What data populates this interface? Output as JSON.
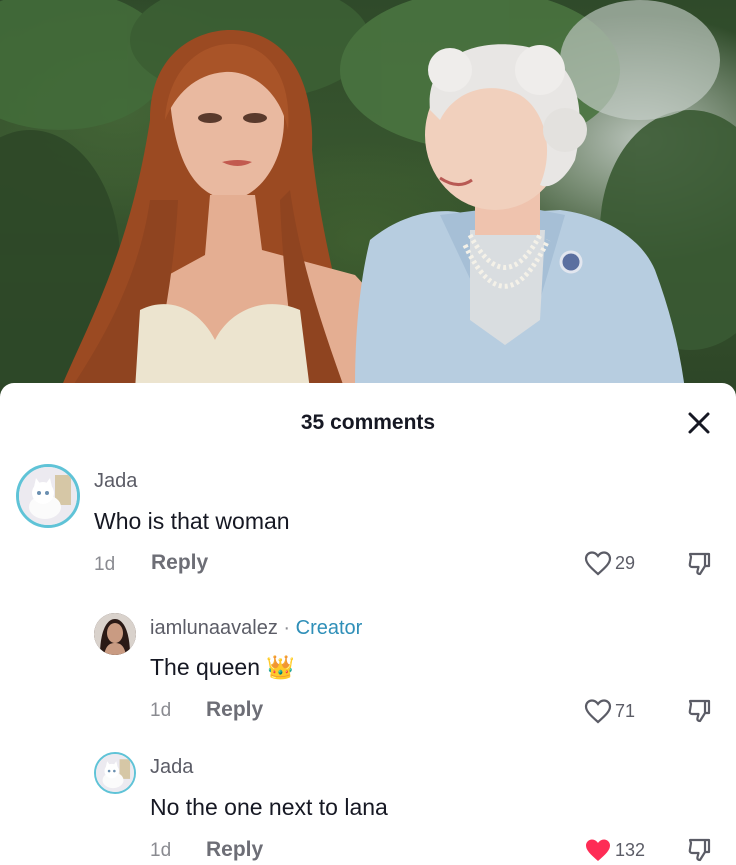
{
  "sheet": {
    "title": "35 comments",
    "close_icon": "close-icon"
  },
  "comments": [
    {
      "username": "Jada",
      "text": "Who is that woman",
      "time": "1d",
      "reply_label": "Reply",
      "likes": "29",
      "liked": false
    },
    {
      "username": "iamlunaavalez",
      "separator": " · ",
      "badge": "Creator",
      "text": "The queen",
      "emoji": "👑",
      "time": "1d",
      "reply_label": "Reply",
      "likes": "71",
      "liked": false
    },
    {
      "username": "Jada",
      "text": "No the one next to lana",
      "time": "1d",
      "reply_label": "Reply",
      "likes": "132",
      "liked": true
    }
  ],
  "colors": {
    "liked_heart": "#fe2c55",
    "creator_badge": "#2f8fb8",
    "avatar_ring": "#5fc3d7"
  }
}
